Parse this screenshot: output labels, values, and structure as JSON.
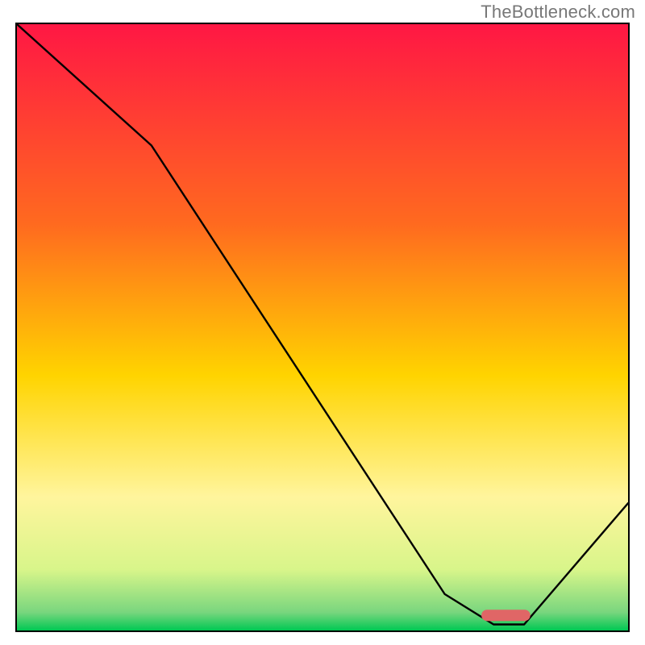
{
  "watermark": {
    "text": "TheBottleneck.com"
  },
  "chart_data": {
    "type": "line",
    "title": "",
    "xlabel": "",
    "ylabel": "",
    "xlim": [
      0,
      100
    ],
    "ylim": [
      0,
      100
    ],
    "grid": false,
    "legend": false,
    "gradient_stops": [
      {
        "offset": 0,
        "color": "#ff1744"
      },
      {
        "offset": 33,
        "color": "#ff6a1f"
      },
      {
        "offset": 58,
        "color": "#ffd400"
      },
      {
        "offset": 78,
        "color": "#fff59d"
      },
      {
        "offset": 90,
        "color": "#d8f58a"
      },
      {
        "offset": 97,
        "color": "#79d67e"
      },
      {
        "offset": 100,
        "color": "#00c853"
      }
    ],
    "curve": {
      "x": [
        0,
        22,
        70,
        78,
        83,
        100
      ],
      "y": [
        100,
        80,
        6,
        1,
        1,
        21
      ]
    },
    "marker": {
      "x_start": 76,
      "x_end": 84,
      "y": 2.5,
      "color": "#e06666"
    }
  }
}
